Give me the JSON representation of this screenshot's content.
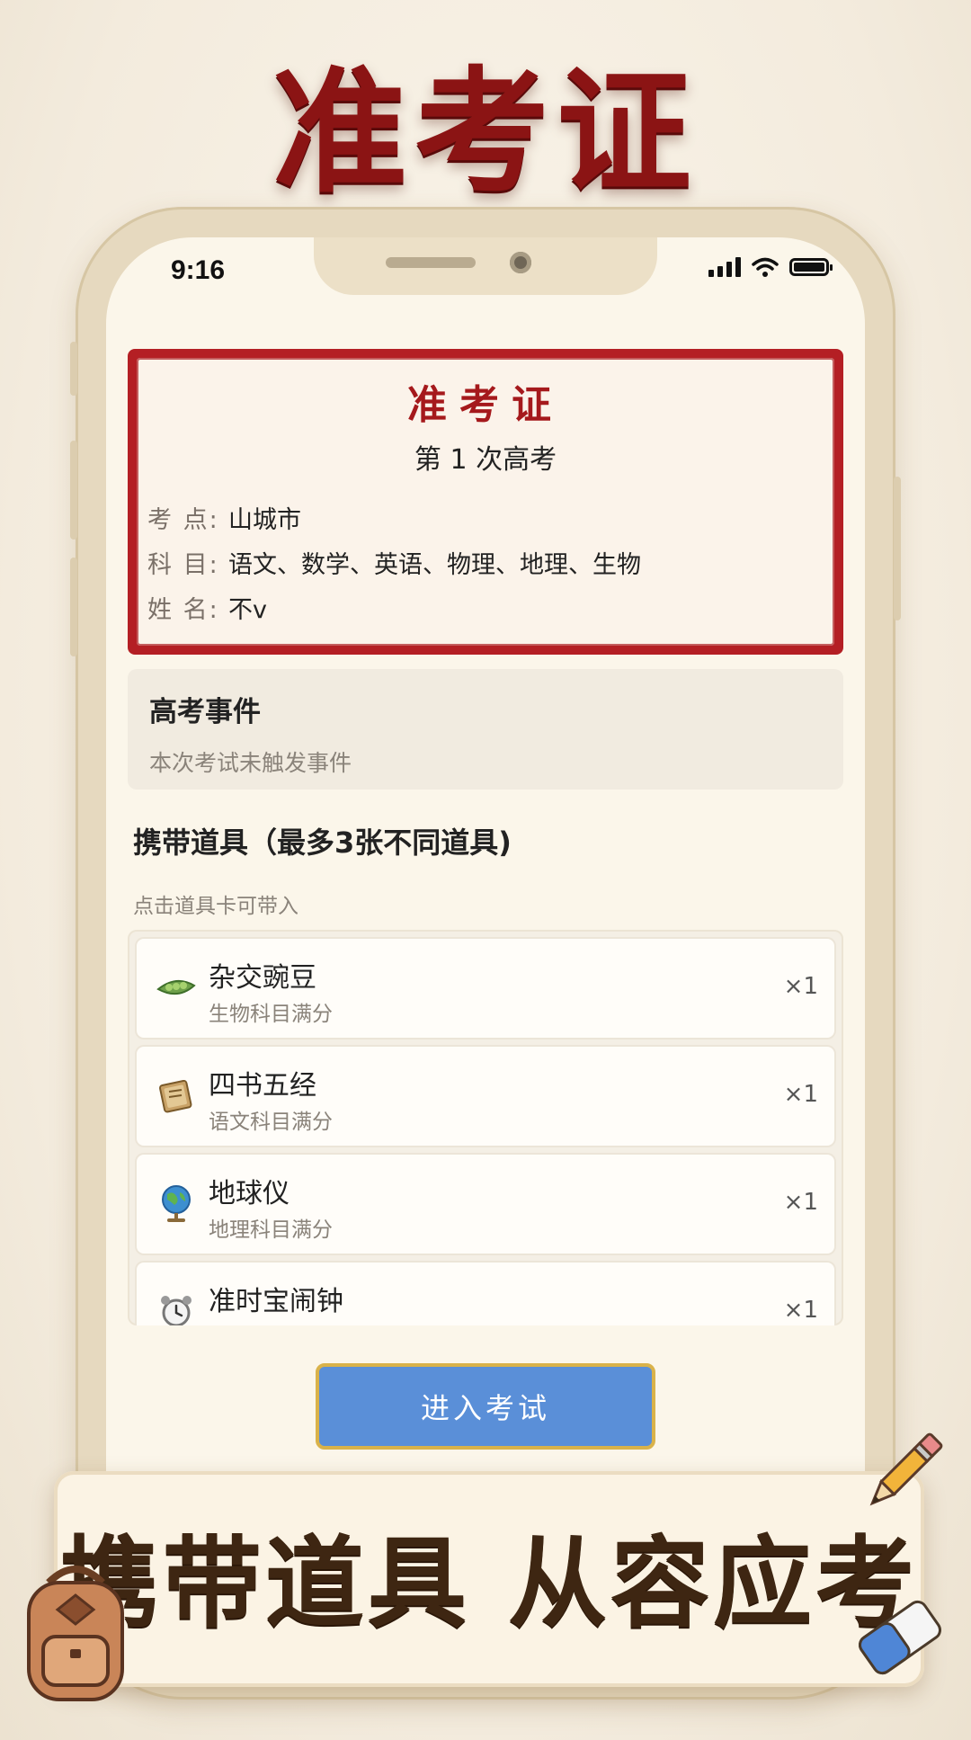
{
  "promo": {
    "title": "准考证",
    "banner": "携带道具 从容应考"
  },
  "status_bar": {
    "time": "9:16"
  },
  "admit_card": {
    "title": "准考证",
    "subtitle": "第 1 次高考",
    "rows": [
      {
        "label": "考 点:",
        "value": "山城市"
      },
      {
        "label": "科 目:",
        "value": "语文、数学、英语、物理、地理、生物"
      },
      {
        "label": "姓 名:",
        "value": "不v"
      }
    ]
  },
  "event": {
    "title": "高考事件",
    "description": "本次考试未触发事件"
  },
  "props_section": {
    "title": "携带道具（最多3张不同道具)",
    "hint": "点击道具卡可带入",
    "items": [
      {
        "name": "杂交豌豆",
        "desc": "生物科目满分",
        "count": "×1",
        "icon": "pea-pod-icon"
      },
      {
        "name": "四书五经",
        "desc": "语文科目满分",
        "count": "×1",
        "icon": "books-icon"
      },
      {
        "name": "地球仪",
        "desc": "地理科目满分",
        "count": "×1",
        "icon": "globe-icon"
      },
      {
        "name": "准时宝闹钟",
        "desc": "",
        "count": "×1",
        "icon": "alarm-clock-icon"
      }
    ]
  },
  "enter_button": {
    "label": "进入考试"
  },
  "colors": {
    "accent_red": "#b41f24",
    "button_blue": "#5a8fd8",
    "button_border": "#d9b24a",
    "background": "#f7f0e3"
  }
}
